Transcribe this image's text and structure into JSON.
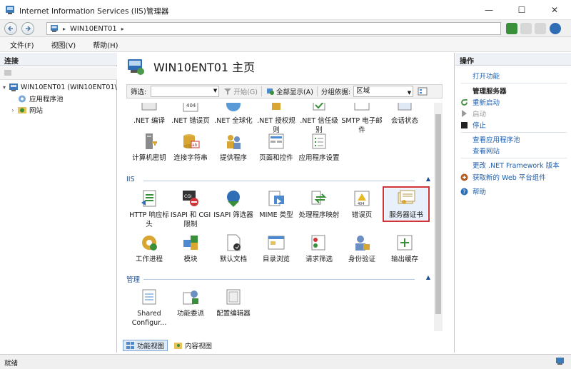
{
  "window": {
    "title": "Internet Information Services (IIS)管理器",
    "min_glyph": "—",
    "max_glyph": "☐",
    "close_glyph": "✕"
  },
  "address": {
    "path": "WIN10ENT01",
    "separator": "▸"
  },
  "menu": [
    "文件(F)",
    "视图(V)",
    "帮助(H)"
  ],
  "connections": {
    "header": "连接",
    "tree": [
      {
        "label": "WIN10ENT01 (WIN10ENT01\\",
        "expand": "▾",
        "icon": "server-icon"
      },
      {
        "label": "应用程序池",
        "expand": "",
        "icon": "app-pools-icon"
      },
      {
        "label": "网站",
        "expand": "›",
        "icon": "sites-icon"
      }
    ]
  },
  "center": {
    "title": "WIN10ENT01 主页",
    "filter": {
      "label": "筛选:",
      "go_label": "开始(G)",
      "show_all_label": "全部显示(A)",
      "group_label": "分组依据:",
      "group_value": "区域"
    },
    "row0": [
      ".NET 编译",
      ".NET 错误页",
      ".NET 全球化",
      ".NET 授权规则",
      ".NET 信任级别",
      "SMTP 电子邮件",
      "会话状态"
    ],
    "row1": [
      "计算机密钥",
      "连接字符串",
      "提供程序",
      "页面和控件",
      "应用程序设置"
    ],
    "groups": {
      "iis": "IIS",
      "manage": "管理"
    },
    "iis_row1": [
      "HTTP 响应标头",
      "ISAPI 和 CGI 限制",
      "ISAPI 筛选器",
      "MIME 类型",
      "处理程序映射",
      "错误页",
      "服务器证书"
    ],
    "iis_row2": [
      "工作进程",
      "模块",
      "默认文档",
      "目录浏览",
      "请求筛选",
      "身份验证",
      "输出缓存"
    ],
    "manage_row": [
      "Shared Configur...",
      "功能委派",
      "配置编辑器"
    ],
    "views": {
      "features": "功能视图",
      "content": "内容视图"
    },
    "expand_glyph": "▲"
  },
  "actions": {
    "header": "操作",
    "open_feature": "打开功能",
    "manage_server": "管理服务器",
    "restart": "重新启动",
    "start": "启动",
    "stop": "停止",
    "view_pools": "查看应用程序池",
    "view_sites": "查看网站",
    "change_net": "更改 .NET Framework 版本",
    "get_new": "获取新的 Web 平台组件",
    "help": "帮助"
  },
  "status": {
    "text": "就绪"
  },
  "colors": {
    "accent": "#1f5fae",
    "selection_outline": "#d13438",
    "group_header": "#1f4e8c"
  }
}
